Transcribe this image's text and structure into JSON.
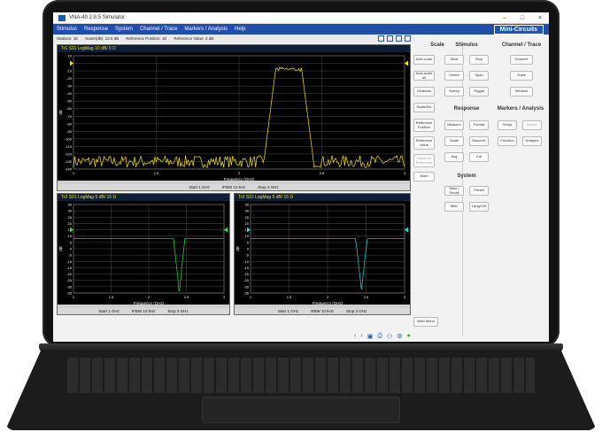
{
  "window": {
    "title": "VNA-40 2.8.5 Simulator",
    "controls": [
      "–",
      "□",
      "×"
    ]
  },
  "menu": [
    "Stimulus",
    "Response",
    "System",
    "Channel / Trace",
    "Markers / Analysis",
    "Help"
  ],
  "brand": "Mini-Circuits",
  "status": {
    "items": [
      "Stations: 1E",
      "Noise(dB): 13.6 dB",
      "Reference Position: 1E",
      "Reference Value: 3 dB"
    ]
  },
  "plots": {
    "top": {
      "header": "Tr1 S11 LogMag 10 dB/ 0 D",
      "ylabel": "dB",
      "xlabel": "Frequency (GHz)",
      "yticks": [
        "10",
        "0",
        "-10",
        "-20",
        "-30",
        "-40",
        "-50",
        "-60",
        "-70",
        "-80",
        "-90",
        "-100",
        "-110",
        "-120",
        "-130",
        "-140"
      ],
      "xticks": [
        "1",
        "1.5",
        "2",
        "2.5",
        "3"
      ],
      "footer": [
        "Start 1 GHz",
        "IFBW 10 kHz",
        "Stop 3 GHz"
      ],
      "trace_color": "#ffe600"
    },
    "left": {
      "header": "Tr2 S21 LogMag 5 dB/ 15 D",
      "ylabel": "dB",
      "xlabel": "Frequency (GHz)",
      "yticks": [
        "35",
        "30",
        "25",
        "20",
        "15",
        "10",
        "5",
        "0",
        "-5",
        "-10",
        "-15",
        "-20",
        "-25",
        "-30",
        "-35"
      ],
      "xticks": [
        "1",
        "1.5",
        "2",
        "2.5",
        "3"
      ],
      "footer": [
        "Start 1 GHz",
        "IFBW 10 kHz",
        "Stop 3 GHz"
      ],
      "trace_color": "#27e63a"
    },
    "right": {
      "header": "Tr3 S31 LogMag 5 dB/ 15 D",
      "ylabel": "dB",
      "xlabel": "Frequency (GHz)",
      "yticks": [
        "35",
        "30",
        "25",
        "20",
        "15",
        "10",
        "5",
        "0",
        "-5",
        "-10",
        "-15",
        "-20",
        "-25",
        "-30",
        "-35"
      ],
      "xticks": [
        "1",
        "1.5",
        "2",
        "2.5",
        "3"
      ],
      "footer": [
        "Start 1 GHz",
        "RBW 10 kHz",
        "Stop 3 GHz"
      ],
      "trace_color": "#25d8d8"
    }
  },
  "scale": {
    "title": "Scale",
    "buttons": [
      "Auto scale",
      "Auto scale all",
      "Divisions",
      "Scale/Div",
      "Reference Position",
      "Reference Value",
      "Match to Reference",
      "More"
    ]
  },
  "stimulus": {
    "title": "Stimulus",
    "buttons": [
      "Start",
      "Stop",
      "Center",
      "Span",
      "Sweep",
      "Trigger"
    ]
  },
  "channel": {
    "title": "Channel / Trace",
    "buttons": [
      "Channel",
      "Trace",
      "Window"
    ]
  },
  "response": {
    "title": "Response",
    "buttons": [
      "Measure",
      "Format",
      "Scale",
      "Discover",
      "Avg",
      "Cal"
    ]
  },
  "markers": {
    "title": "Markers / Analysis",
    "buttons": [
      "Setup",
      "Search",
      "Function",
      "Analysis"
    ]
  },
  "system": {
    "title": "System",
    "buttons": [
      "Save / Recall",
      "Preset",
      "Misc",
      "Lang/Ctrl"
    ]
  },
  "main_menu_button": "Main Menu"
}
